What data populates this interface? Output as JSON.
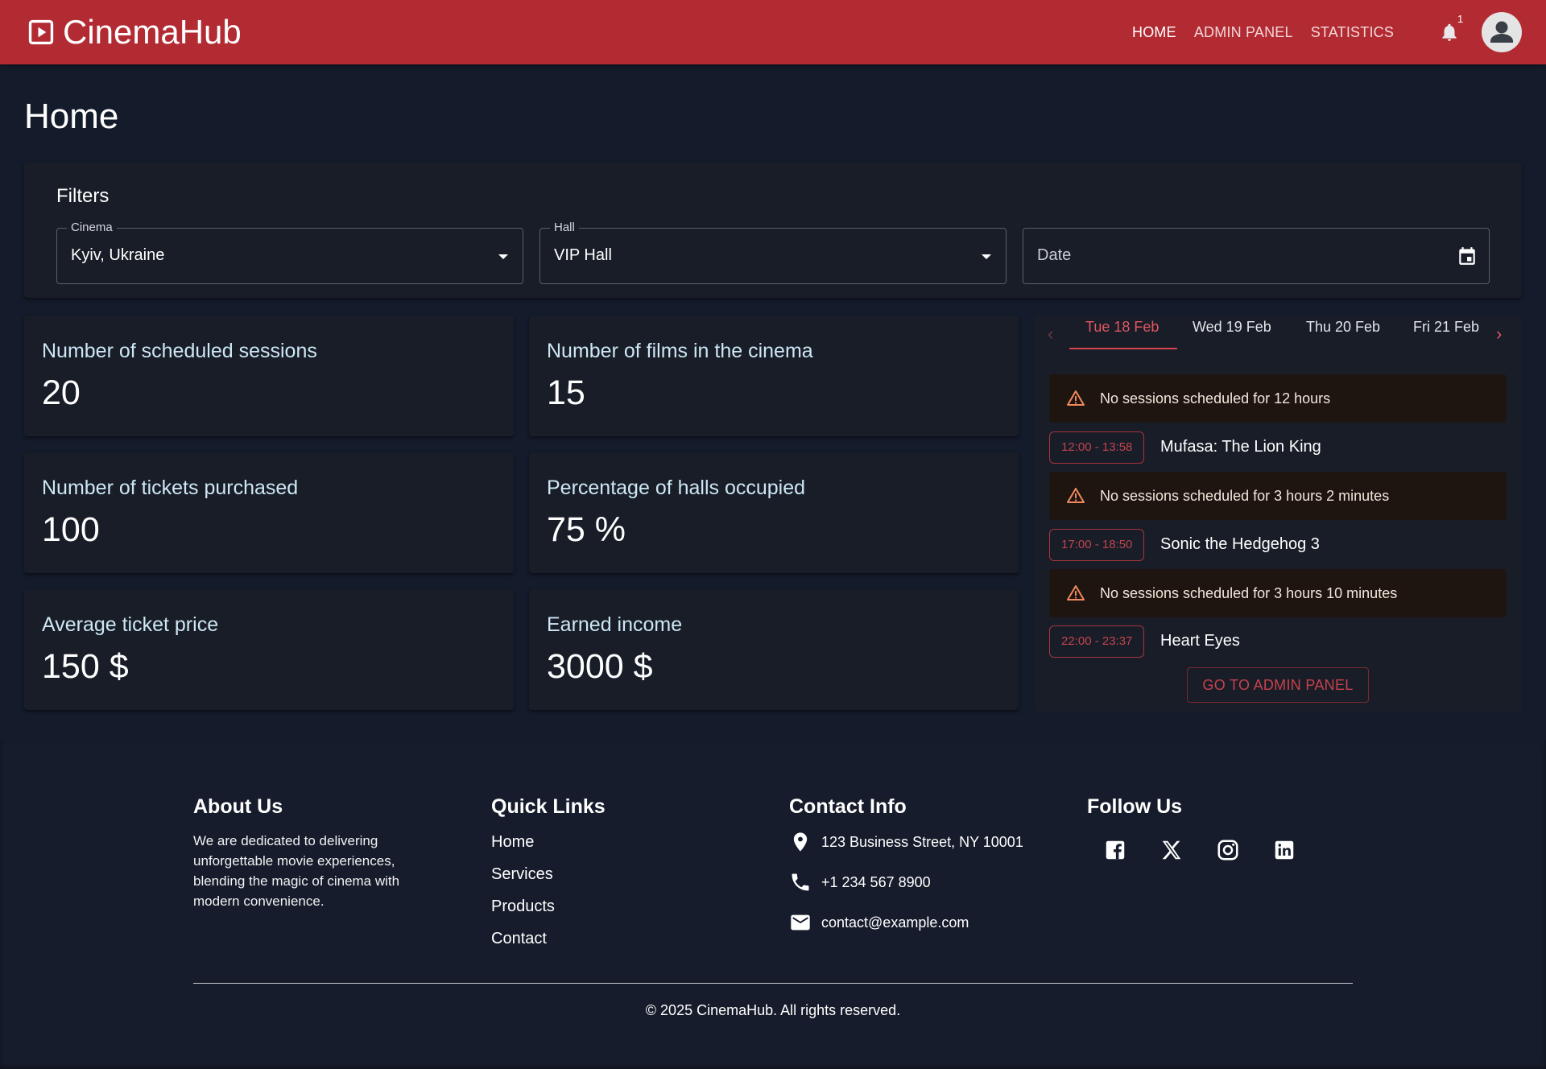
{
  "header": {
    "brand": "CinemaHub",
    "nav": [
      {
        "label": "HOME",
        "active": true
      },
      {
        "label": "ADMIN PANEL",
        "active": false
      },
      {
        "label": "STATISTICS",
        "active": false
      }
    ],
    "notification_count": "1",
    "accent_color": "#b22b33"
  },
  "page": {
    "title": "Home"
  },
  "filters": {
    "title": "Filters",
    "cinema": {
      "label": "Cinema",
      "value": "Kyiv, Ukraine"
    },
    "hall": {
      "label": "Hall",
      "value": "VIP Hall"
    },
    "date": {
      "placeholder": "Date"
    }
  },
  "stats": [
    {
      "label": "Number of scheduled sessions",
      "value": "20"
    },
    {
      "label": "Number of films in the cinema",
      "value": "15"
    },
    {
      "label": "Number of tickets purchased",
      "value": "100"
    },
    {
      "label": "Percentage of halls occupied",
      "value": "75 %"
    },
    {
      "label": "Average ticket price",
      "value": "150 $"
    },
    {
      "label": "Earned income",
      "value": "3000 $"
    }
  ],
  "schedule": {
    "tabs": [
      {
        "label": "Tue 18 Feb",
        "active": true
      },
      {
        "label": "Wed 19 Feb",
        "active": false
      },
      {
        "label": "Thu 20 Feb",
        "active": false
      },
      {
        "label": "Fri 21 Feb",
        "active": false
      }
    ],
    "entries": [
      {
        "kind": "alert",
        "text": "No sessions scheduled for 12 hours"
      },
      {
        "kind": "session",
        "time": "12:00 - 13:58",
        "title": "Mufasa: The Lion King"
      },
      {
        "kind": "alert",
        "text": "No sessions scheduled for 3 hours 2 minutes"
      },
      {
        "kind": "session",
        "time": "17:00 - 18:50",
        "title": "Sonic the Hedgehog 3"
      },
      {
        "kind": "alert",
        "text": "No sessions scheduled for 3 hours 10 minutes"
      },
      {
        "kind": "session",
        "time": "22:00 - 23:37",
        "title": "Heart Eyes"
      }
    ],
    "admin_button": "GO TO ADMIN PANEL"
  },
  "footer": {
    "about": {
      "title": "About Us",
      "text": "We are dedicated to delivering unforgettable movie experiences, blending the magic of cinema with modern convenience."
    },
    "quick_links": {
      "title": "Quick Links",
      "items": [
        "Home",
        "Services",
        "Products",
        "Contact"
      ]
    },
    "contact": {
      "title": "Contact Info",
      "address": "123 Business Street, NY 10001",
      "phone": "+1 234 567 8900",
      "email": "contact@example.com"
    },
    "follow": {
      "title": "Follow Us",
      "icons": [
        "facebook-icon",
        "x-icon",
        "instagram-icon",
        "linkedin-icon"
      ]
    },
    "copyright": "© 2025 CinemaHub. All rights reserved."
  }
}
